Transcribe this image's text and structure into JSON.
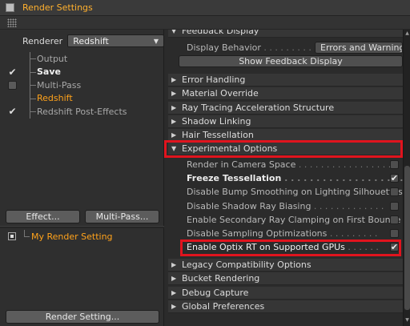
{
  "window": {
    "title": "Render Settings"
  },
  "left": {
    "renderer_label": "Renderer",
    "renderer_value": "Redshift",
    "tree": [
      {
        "label": "Output",
        "check": "none",
        "style": "dim"
      },
      {
        "label": "Save",
        "check": "tick",
        "style": "bold"
      },
      {
        "label": "Multi-Pass",
        "check": "box",
        "style": "dim"
      },
      {
        "label": "Redshift",
        "check": "none",
        "style": "orange"
      },
      {
        "label": "Redshift Post-Effects",
        "check": "tick",
        "style": "dim"
      }
    ],
    "effect_button": "Effect...",
    "multipass_button": "Multi-Pass...",
    "setting_item": "My Render Setting",
    "render_setting_button": "Render Setting..."
  },
  "right": {
    "feedback_header": "Feedback Display",
    "display_behavior_label": "Display Behavior",
    "display_behavior_value": "Errors and Warnings",
    "show_feedback_button": "Show Feedback Display",
    "sections_top": [
      "Error Handling",
      "Material Override",
      "Ray Tracing Acceleration Structure",
      "Shadow Linking",
      "Hair Tessellation"
    ],
    "experimental_header": "Experimental Options",
    "options": [
      {
        "label": "Render in Camera Space",
        "checked": false,
        "style": "normal"
      },
      {
        "label": "Freeze Tessellation",
        "checked": true,
        "style": "bold"
      },
      {
        "label": "Disable Bump Smoothing on Lighting Silhouettes",
        "checked": false,
        "style": "normal"
      },
      {
        "label": "Disable Shadow Ray Biasing",
        "checked": false,
        "style": "normal"
      },
      {
        "label": "Enable Secondary Ray Clamping on First Bounce",
        "checked": false,
        "style": "normal"
      },
      {
        "label": "Disable Sampling Optimizations",
        "checked": false,
        "style": "normal"
      },
      {
        "label": "Enable Optix RT on Supported GPUs",
        "checked": true,
        "style": "white"
      }
    ],
    "sections_bottom": [
      "Legacy Compatibility Options",
      "Bucket Rendering",
      "Debug Capture",
      "Global Preferences"
    ]
  },
  "colors": {
    "accent": "#ffa21b",
    "highlight": "#e0141e",
    "background": "#2b2b2b"
  }
}
